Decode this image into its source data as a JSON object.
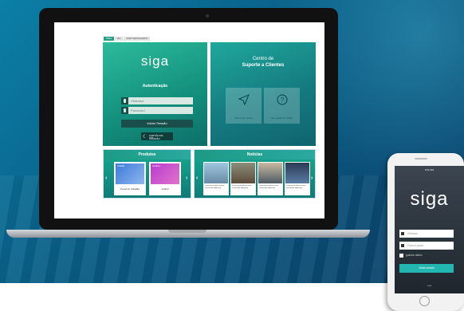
{
  "screen": {
    "tabs": [
      "SIGA",
      "EN",
      "SAIR MENSAGENS"
    ],
    "login": {
      "logo": "siga",
      "title": "Autenticação",
      "username_placeholder": "Utilizador",
      "password_placeholder": "Password",
      "submit_label": "Iniciar Sessão",
      "certificate_label": "CARTÃO DE CIDADÃO"
    },
    "support": {
      "title_line1": "Centro de",
      "title_line2": "Suporte a Clientes",
      "tiles": [
        {
          "icon": "paper-plane-icon",
          "label": "Abrir novo Ticket"
        },
        {
          "icon": "question-icon",
          "label": "Ver estado do Ticket"
        }
      ]
    },
    "products": {
      "title": "Produtos",
      "items": [
        {
          "label": "Portal do Cidadão",
          "top_text": "Cidadão"
        },
        {
          "label": "Gulbuf",
          "top_text": "Na Beira"
        }
      ]
    },
    "news": {
      "title": "Notícias",
      "items": [
        {
          "caption": "Lorem ipsum dolor sit amet, consectetur adipiscing"
        },
        {
          "caption": "Lorem ipsum dolor sit amet, consectetur adipiscing"
        },
        {
          "caption": "Lorem ipsum dolor sit amet, consectetur adipiscing"
        },
        {
          "caption": "Lorem ipsum dolor sit amet, consectetur adipiscing"
        }
      ]
    }
  },
  "phone": {
    "time": "9:41 AM",
    "logo": "siga",
    "username_placeholder": "Utilizador",
    "password_placeholder": "Palavra-passe",
    "remember_label": "guardar dados",
    "submit_label": "Iniciar sessão",
    "footer": "siga"
  },
  "colors": {
    "accent": "#1fa89c",
    "dark_teal": "#1a4e4a",
    "phone_button": "#23b5b0"
  }
}
